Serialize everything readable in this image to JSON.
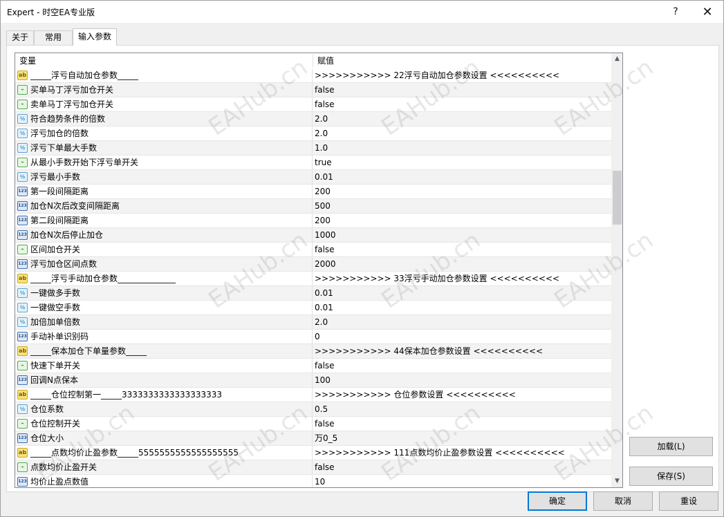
{
  "window": {
    "title": "Expert - 时空EA专业版",
    "help_glyph": "?",
    "close_glyph": "✕"
  },
  "tabs": [
    {
      "label": "关于"
    },
    {
      "label": "常用"
    },
    {
      "label": "输入参数",
      "active": true
    }
  ],
  "grid": {
    "columns": {
      "variable": "变量",
      "value": "赋值"
    },
    "rows": [
      {
        "icon": "string-icon",
        "type": "str",
        "name": "_____浮亏自动加仓参数_____",
        "value": ">>>>>>>>>>> 22浮亏自动加仓参数设置 <<<<<<<<<<"
      },
      {
        "icon": "bool-icon",
        "type": "bool",
        "name": "买单马丁浮亏加仓开关",
        "value": "false"
      },
      {
        "icon": "bool-icon",
        "type": "bool",
        "name": "卖单马丁浮亏加仓开关",
        "value": "false"
      },
      {
        "icon": "double-icon",
        "type": "dbl",
        "name": "符合趋势条件的倍数",
        "value": "2.0"
      },
      {
        "icon": "double-icon",
        "type": "dbl",
        "name": "浮亏加仓的倍数",
        "value": "2.0"
      },
      {
        "icon": "double-icon",
        "type": "dbl",
        "name": "浮亏下单最大手数",
        "value": "1.0"
      },
      {
        "icon": "bool-icon",
        "type": "bool",
        "name": "从最小手数开始下浮亏单开关",
        "value": "true"
      },
      {
        "icon": "double-icon",
        "type": "dbl",
        "name": "浮亏最小手数",
        "value": "0.01"
      },
      {
        "icon": "int-icon",
        "type": "int",
        "name": "第一段间隔距离",
        "value": "200"
      },
      {
        "icon": "int-icon",
        "type": "int",
        "name": "加仓N次后改变间隔距离",
        "value": "500"
      },
      {
        "icon": "int-icon",
        "type": "int",
        "name": "第二段间隔距离",
        "value": "200"
      },
      {
        "icon": "int-icon",
        "type": "int",
        "name": "加仓N次后停止加仓",
        "value": "1000"
      },
      {
        "icon": "bool-icon",
        "type": "bool",
        "name": "区间加仓开关",
        "value": "false"
      },
      {
        "icon": "int-icon",
        "type": "int",
        "name": "浮亏加仓区间点数",
        "value": "2000"
      },
      {
        "icon": "string-icon",
        "type": "str",
        "name": "_____浮亏手动加仓参数______________",
        "value": ">>>>>>>>>>> 33浮亏手动加仓参数设置 <<<<<<<<<<"
      },
      {
        "icon": "double-icon",
        "type": "dbl",
        "name": "一键做多手数",
        "value": "0.01"
      },
      {
        "icon": "double-icon",
        "type": "dbl",
        "name": "一键做空手数",
        "value": "0.01"
      },
      {
        "icon": "double-icon",
        "type": "dbl",
        "name": "加倍加单倍数",
        "value": "2.0"
      },
      {
        "icon": "int-icon",
        "type": "int",
        "name": "手动补单识别码",
        "value": "0"
      },
      {
        "icon": "string-icon",
        "type": "str",
        "name": "_____保本加仓下单量参数_____",
        "value": ">>>>>>>>>>> 44保本加仓参数设置 <<<<<<<<<<"
      },
      {
        "icon": "bool-icon",
        "type": "bool",
        "name": "快速下单开关",
        "value": "false"
      },
      {
        "icon": "int-icon",
        "type": "int",
        "name": "回调N点保本",
        "value": "100"
      },
      {
        "icon": "string-icon",
        "type": "str",
        "name": "_____仓位控制第一_____3333333333333333333",
        "value": ">>>>>>>>>>> 仓位参数设置 <<<<<<<<<<"
      },
      {
        "icon": "double-icon",
        "type": "dbl",
        "name": "仓位系数",
        "value": "0.5"
      },
      {
        "icon": "bool-icon",
        "type": "bool",
        "name": "仓位控制开关",
        "value": "false"
      },
      {
        "icon": "int-icon",
        "type": "int",
        "name": "仓位大小",
        "value": "万0_5"
      },
      {
        "icon": "string-icon",
        "type": "str",
        "name": "_____点数均价止盈参数_____5555555555555555555",
        "value": ">>>>>>>>>>> 111点数均价止盈参数设置 <<<<<<<<<<"
      },
      {
        "icon": "bool-icon",
        "type": "bool",
        "name": "点数均价止盈开关",
        "value": "false"
      },
      {
        "icon": "int-icon",
        "type": "int",
        "name": "均价止盈点数值",
        "value": "10"
      }
    ],
    "icon_glyphs": {
      "str": "ab",
      "bool": "⌁",
      "dbl": "½",
      "int": "123"
    }
  },
  "watermark": "EAHub.cn",
  "side_buttons": {
    "load": "加载(L)",
    "save": "保存(S)"
  },
  "footer_buttons": {
    "ok": "确定",
    "cancel": "取消",
    "reset": "重设"
  },
  "scrollbar": {
    "up_glyph": "▲",
    "down_glyph": "▼",
    "position_fraction": 0.27
  }
}
